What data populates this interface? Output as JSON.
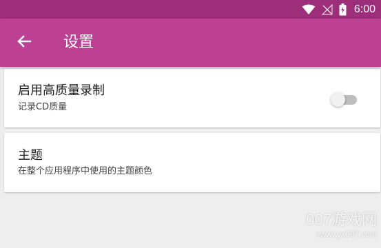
{
  "status_bar": {
    "time": "6:00",
    "icons": [
      "wifi-icon",
      "no-signal-icon",
      "battery-charging-icon"
    ],
    "color": "#9c2e7a"
  },
  "app_bar": {
    "title": "设置",
    "back_icon": "arrow-back-icon",
    "color": "#bd4093"
  },
  "settings": [
    {
      "title": "启用高质量录制",
      "subtitle": "记录CD质量",
      "toggle": {
        "on": false
      }
    },
    {
      "title": "主题",
      "subtitle": "在整个应用程序中使用的主题颜色"
    }
  ],
  "watermark": {
    "brand": "007游戏网",
    "url": "www.yx007.com"
  }
}
